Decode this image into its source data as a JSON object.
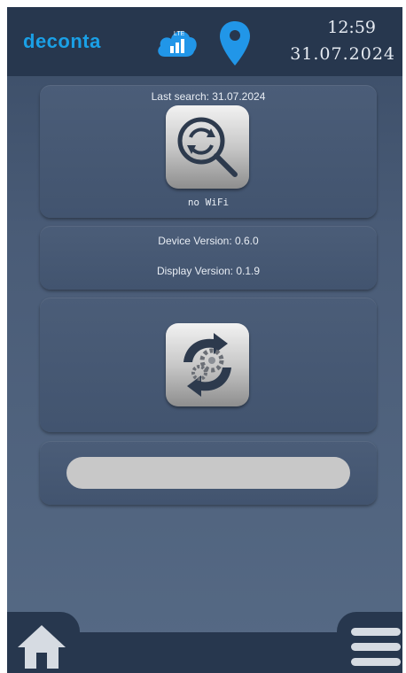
{
  "header": {
    "brand": "deconta",
    "cloud_icon": "cloud-signal-icon",
    "cloud_label": "LTE",
    "location_icon": "location-pin-icon",
    "time": "12:59",
    "date": "31.07.2024",
    "brand_color": "#1aa0e6",
    "accent_color": "#2196e8"
  },
  "search_card": {
    "last_search": "Last search: 31.07.2024",
    "button_icon": "search-refresh-icon",
    "wifi_status": "no WiFi"
  },
  "version_card": {
    "device_version": "Device Version: 0.6.0",
    "display_version": "Display Version: 0.1.9"
  },
  "update_card": {
    "button_icon": "sync-settings-icon"
  },
  "progress_card": {
    "progress": 0
  },
  "nav": {
    "home_icon": "home-icon",
    "menu_icon": "menu-icon"
  }
}
